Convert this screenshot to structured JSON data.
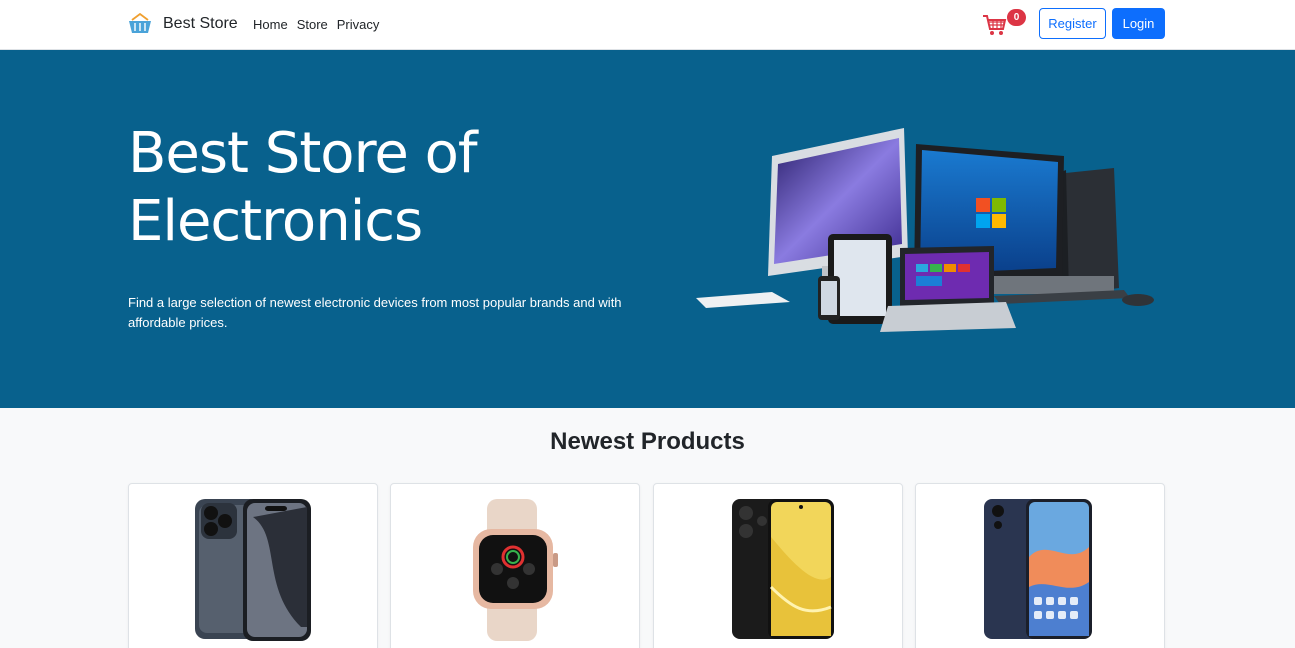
{
  "navbar": {
    "brand": "Best Store",
    "links": [
      "Home",
      "Store",
      "Privacy"
    ],
    "cart_count": "0",
    "register_label": "Register",
    "login_label": "Login"
  },
  "hero": {
    "title": "Best Store of Electronics",
    "description": "Find a large selection of newest electronic devices from most popular brands and with affordable prices."
  },
  "products": {
    "title": "Newest Products",
    "items": [
      {
        "image": "iphone-product-image"
      },
      {
        "image": "smartwatch-product-image"
      },
      {
        "image": "realme-phone-product-image"
      },
      {
        "image": "oppo-phone-product-image"
      }
    ]
  },
  "colors": {
    "hero_bg": "#08618d",
    "primary": "#0d6efd",
    "badge": "#dc3545"
  }
}
